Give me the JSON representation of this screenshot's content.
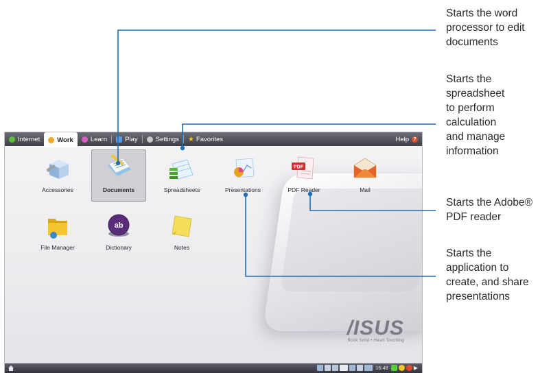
{
  "tabs": [
    {
      "label": "Internet",
      "active": false,
      "icon": "globe-icon",
      "color": "#5bbf3a"
    },
    {
      "label": "Work",
      "active": true,
      "icon": "briefcase-icon",
      "color": "#f0a62a"
    },
    {
      "label": "Learn",
      "active": false,
      "icon": "book-icon",
      "color": "#d95fc2"
    },
    {
      "label": "Play",
      "active": false,
      "icon": "gamepad-icon",
      "color": "#5a9be0"
    },
    {
      "label": "Settings",
      "active": false,
      "icon": "gear-icon",
      "color": "#c8c8c8"
    },
    {
      "label": "Favorites",
      "active": false,
      "icon": "star-icon",
      "color": "#f5c518"
    }
  ],
  "help": {
    "label": "Help",
    "icon": "help-icon"
  },
  "apps": [
    {
      "label": "Accessories",
      "icon": "accessories-icon"
    },
    {
      "label": "Documents",
      "icon": "documents-icon",
      "selected": true
    },
    {
      "label": "Spreadsheets",
      "icon": "spreadsheets-icon"
    },
    {
      "label": "Presentations",
      "icon": "presentations-icon"
    },
    {
      "label": "PDF Reader",
      "icon": "pdf-reader-icon"
    },
    {
      "label": "Mail",
      "icon": "mail-icon"
    },
    {
      "label": "File Manager",
      "icon": "file-manager-icon"
    },
    {
      "label": "Dictionary",
      "icon": "dictionary-icon"
    },
    {
      "label": "Notes",
      "icon": "notes-icon"
    }
  ],
  "wallpaper": {
    "brand": "/ISUS",
    "tagline": "Rock Solid • Heart Touching"
  },
  "taskbar": {
    "clock": "16:48",
    "home_icon": "home-icon"
  },
  "callouts": {
    "documents": [
      "Starts the word",
      "processor to edit",
      "documents"
    ],
    "spreadsheets": [
      "Starts the",
      "spreadsheet",
      "to perform",
      "calculation",
      "and manage",
      "information"
    ],
    "pdf": [
      "Starts the Adobe®",
      "PDF reader"
    ],
    "presentations": [
      "Starts the",
      "application to",
      "create, and share",
      "presentations"
    ]
  },
  "colors": {
    "leader_line": "#1f6fb2",
    "tab_bar": "#4a4a52",
    "selected_tile": "#cfcfd4"
  }
}
